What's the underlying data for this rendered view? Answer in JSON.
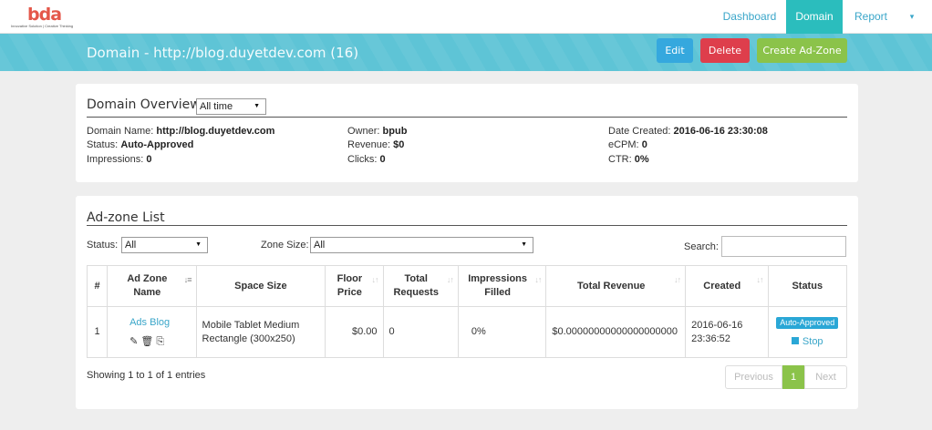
{
  "brand": {
    "logo_text": "bda",
    "tagline": "Innovative Solution | Creative Thinking"
  },
  "nav": {
    "dashboard": "Dashboard",
    "domain": "Domain",
    "report": "Report",
    "caret": "▾"
  },
  "banner": {
    "title": "Domain - http://blog.duyetdev.com (16)"
  },
  "actions": {
    "edit": "Edit",
    "delete": "Delete",
    "create": "Create Ad-Zone"
  },
  "overview": {
    "title": "Domain Overview",
    "range_select": "All time",
    "domain_name_label": "Domain Name:",
    "domain_name": "http://blog.duyetdev.com",
    "status_label": "Status:",
    "status": "Auto-Approved",
    "impressions_label": "Impressions:",
    "impressions": "0",
    "owner_label": "Owner:",
    "owner": "bpub",
    "revenue_label": "Revenue:",
    "revenue": "$0",
    "clicks_label": "Clicks:",
    "clicks": "0",
    "date_created_label": "Date Created:",
    "date_created": "2016-06-16 23:30:08",
    "ecpm_label": "eCPM:",
    "ecpm": "0",
    "ctr_label": "CTR:",
    "ctr": "0%"
  },
  "adzones": {
    "title": "Ad-zone List",
    "status_label": "Status:",
    "status_value": "All",
    "size_label": "Zone Size:",
    "size_value": "All",
    "search_label": "Search:",
    "columns": {
      "num": "#",
      "name_1": "Ad Zone",
      "name_2": "Name",
      "space": "Space Size",
      "floor_1": "Floor",
      "floor_2": "Price",
      "requests_1": "Total",
      "requests_2": "Requests",
      "filled_1": "Impressions",
      "filled_2": "Filled",
      "revenue": "Total Revenue",
      "created": "Created",
      "status": "Status"
    },
    "rows": [
      {
        "num": "1",
        "name": "Ads Blog",
        "space_1": "Mobile Tablet Medium",
        "space_2": "Rectangle (300x250)",
        "floor": "$0.00",
        "requests": "0",
        "filled": "0%",
        "revenue": "$0.00000000000000000000",
        "created_1": "2016-06-16",
        "created_2": "23:36:52",
        "status": "Auto-Approved",
        "stop": "Stop"
      }
    ],
    "info": "Showing 1 to 1 of 1 entries",
    "pagination": {
      "prev": "Previous",
      "page": "1",
      "next": "Next"
    }
  }
}
